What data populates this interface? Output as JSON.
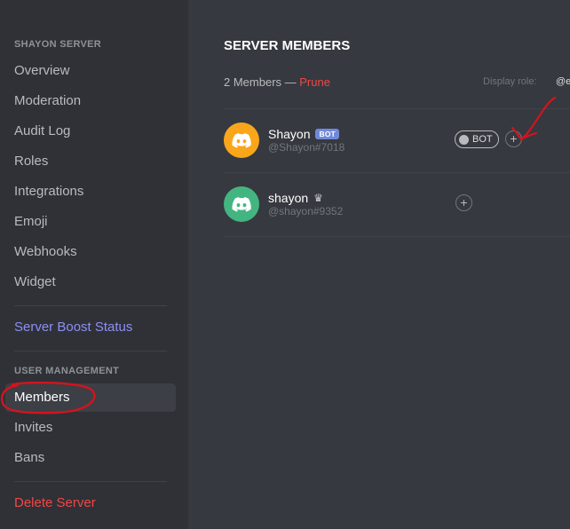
{
  "sidebar": {
    "server_header": "SHAYON SERVER",
    "items": [
      {
        "label": "Overview"
      },
      {
        "label": "Moderation"
      },
      {
        "label": "Audit Log"
      },
      {
        "label": "Roles"
      },
      {
        "label": "Integrations"
      },
      {
        "label": "Emoji"
      },
      {
        "label": "Webhooks"
      },
      {
        "label": "Widget"
      }
    ],
    "boost_label": "Server Boost Status",
    "user_management_header": "USER MANAGEMENT",
    "user_items": [
      {
        "label": "Members",
        "selected": true
      },
      {
        "label": "Invites"
      },
      {
        "label": "Bans"
      }
    ],
    "delete_label": "Delete Server"
  },
  "main": {
    "title": "SERVER MEMBERS",
    "member_count_text": "2 Members —",
    "prune_label": "Prune",
    "display_role_label": "Display role:",
    "display_role_value": "@e",
    "members": [
      {
        "name": "Shayon",
        "badge": "BOT",
        "tag": "@Shayon#7018",
        "avatar_color": "#faa61a",
        "role_label": "BOT"
      },
      {
        "name": "shayon",
        "owner_icon": "crown-icon",
        "tag": "@shayon#9352",
        "avatar_color": "#43b581"
      }
    ],
    "add_role_symbol": "+"
  },
  "colors": {
    "sidebar_bg": "#2f3136",
    "main_bg": "#36393f",
    "danger": "#f04747",
    "boost": "#8c8ff5",
    "bot_badge": "#7289da",
    "annotation_red": "#d2141e"
  }
}
